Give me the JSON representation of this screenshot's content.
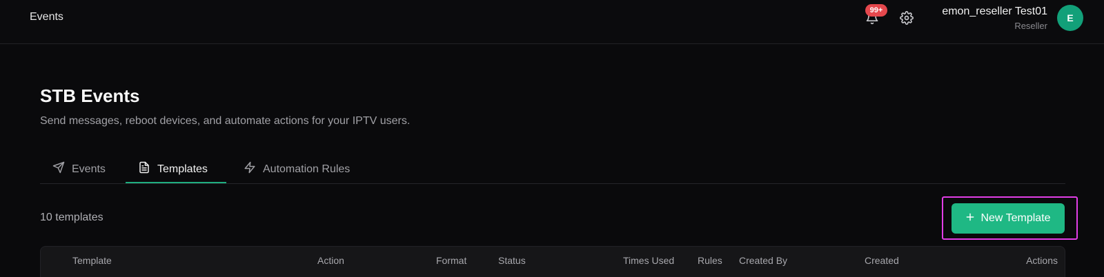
{
  "topbar": {
    "title": "Events",
    "notifications_badge": "99+",
    "user_name": "emon_reseller Test01",
    "user_role": "Reseller",
    "avatar_initial": "E"
  },
  "page": {
    "title": "STB Events",
    "subtitle": "Send messages, reboot devices, and automate actions for your IPTV users."
  },
  "tabs": [
    {
      "label": "Events",
      "icon": "send-icon",
      "active": false
    },
    {
      "label": "Templates",
      "icon": "file-text-icon",
      "active": true
    },
    {
      "label": "Automation Rules",
      "icon": "zap-icon",
      "active": false
    }
  ],
  "toolbar": {
    "count_label": "10 templates",
    "new_button_label": "New Template"
  },
  "table": {
    "columns": [
      "Template",
      "Action",
      "Format",
      "Status",
      "Times Used",
      "Rules",
      "Created By",
      "Created",
      "Actions"
    ]
  },
  "colors": {
    "accent": "#1fb884",
    "badge": "#e5484d",
    "highlight": "#e33ee8",
    "avatar": "#12a079"
  }
}
